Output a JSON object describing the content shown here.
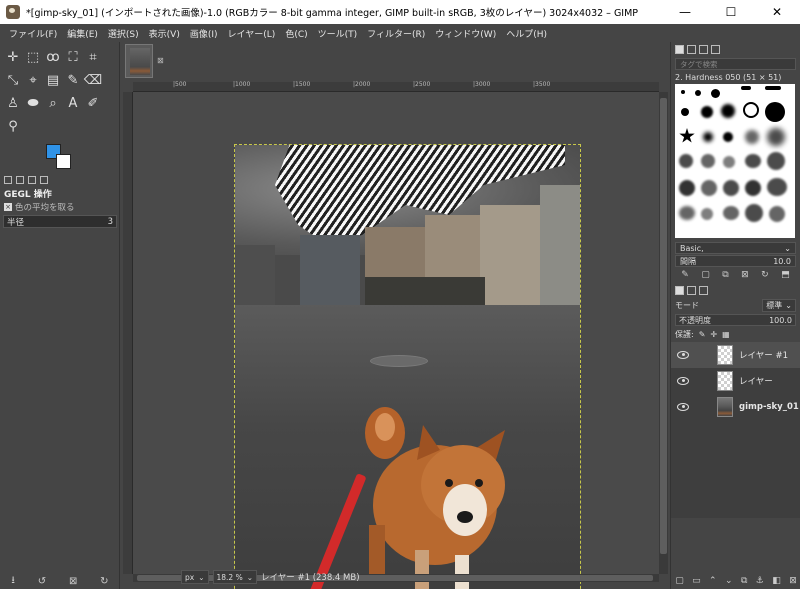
{
  "window": {
    "title": "*[gimp-sky_01] (インポートされた画像)-1.0 (RGBカラー 8-bit gamma integer, GIMP built-in sRGB, 3枚のレイヤー) 3024x4032 – GIMP",
    "minimize": "—",
    "maximize": "☐",
    "close": "✕"
  },
  "menu": [
    "ファイル(F)",
    "編集(E)",
    "選択(S)",
    "表示(V)",
    "画像(I)",
    "レイヤー(L)",
    "色(C)",
    "ツール(T)",
    "フィルター(R)",
    "ウィンドウ(W)",
    "ヘルプ(H)"
  ],
  "toolbox": {
    "tools": [
      "✛",
      "⬚",
      "ꝏ",
      "⛶",
      "⌗",
      "⤡",
      "⌖",
      "▤",
      "✎",
      "⌫",
      "♙",
      "⬬",
      "⌕",
      "A",
      "✐",
      "⚲"
    ],
    "fg_color": "#2f93e8",
    "bg_color": "#ffffff"
  },
  "tool_options": {
    "title": "GEGL 操作",
    "subtitle": "色の平均を取る",
    "radius_label": "半径",
    "radius_value": "3"
  },
  "image_window": {
    "close_tab": "⊠",
    "ruler_labels": [
      "|500",
      "|1000",
      "|1500",
      "|2000",
      "|2500",
      "|3000",
      "|3500"
    ],
    "unit": "px",
    "zoom": "18.2 %",
    "status": "レイヤー #1 (238.4 MB)"
  },
  "brushes": {
    "search_placeholder": "タグで検索",
    "current": "2. Hardness 050 (51 × 51)",
    "preset": "Basic,",
    "spacing_label": "間隔",
    "spacing_value": "10.0"
  },
  "layers": {
    "mode_label": "モード",
    "mode_value": "標準",
    "opacity_label": "不透明度",
    "opacity_value": "100.0",
    "lock_label": "保護:",
    "items": [
      {
        "name": "レイヤー #1",
        "selected": true,
        "bold": false
      },
      {
        "name": "レイヤー",
        "selected": false,
        "bold": false
      },
      {
        "name": "gimp-sky_01",
        "selected": false,
        "bold": true
      }
    ]
  }
}
